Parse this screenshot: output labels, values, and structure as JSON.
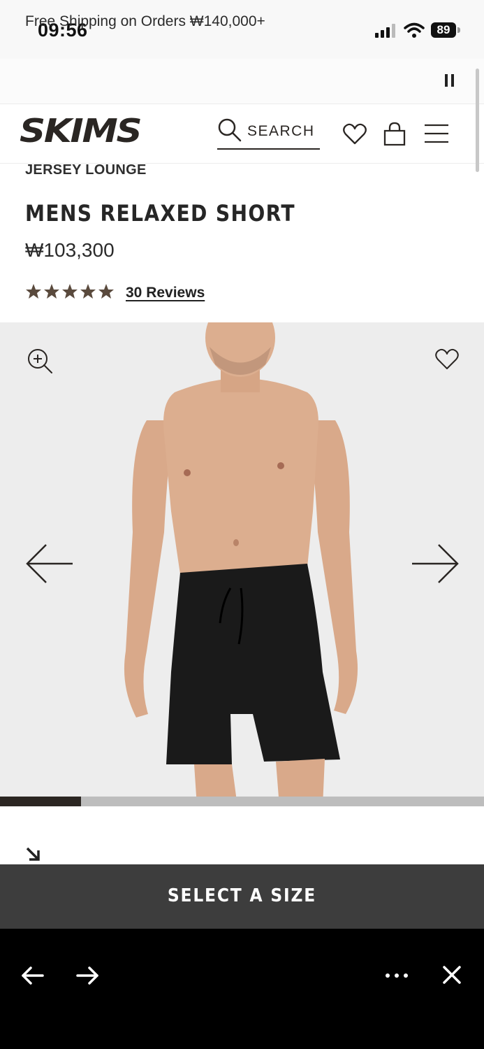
{
  "status_bar": {
    "time": "09:56",
    "battery": "89"
  },
  "promo": {
    "text": "Free Shipping on Orders ₩140,000+"
  },
  "header": {
    "logo": "SKIMS",
    "search_label": "SEARCH"
  },
  "product": {
    "collection": "JERSEY LOUNGE",
    "title": "MENS RELAXED SHORT",
    "price": "₩103,300",
    "rating": 5,
    "reviews_label": "30 Reviews"
  },
  "gallery": {
    "progress": 0.167
  },
  "cta": {
    "label": "SELECT A SIZE"
  },
  "colors": {
    "brand_dark": "#2a2623",
    "cta_bg": "#3d3d3d",
    "star": "#5a4a3d",
    "gallery_bg": "#ededed"
  }
}
